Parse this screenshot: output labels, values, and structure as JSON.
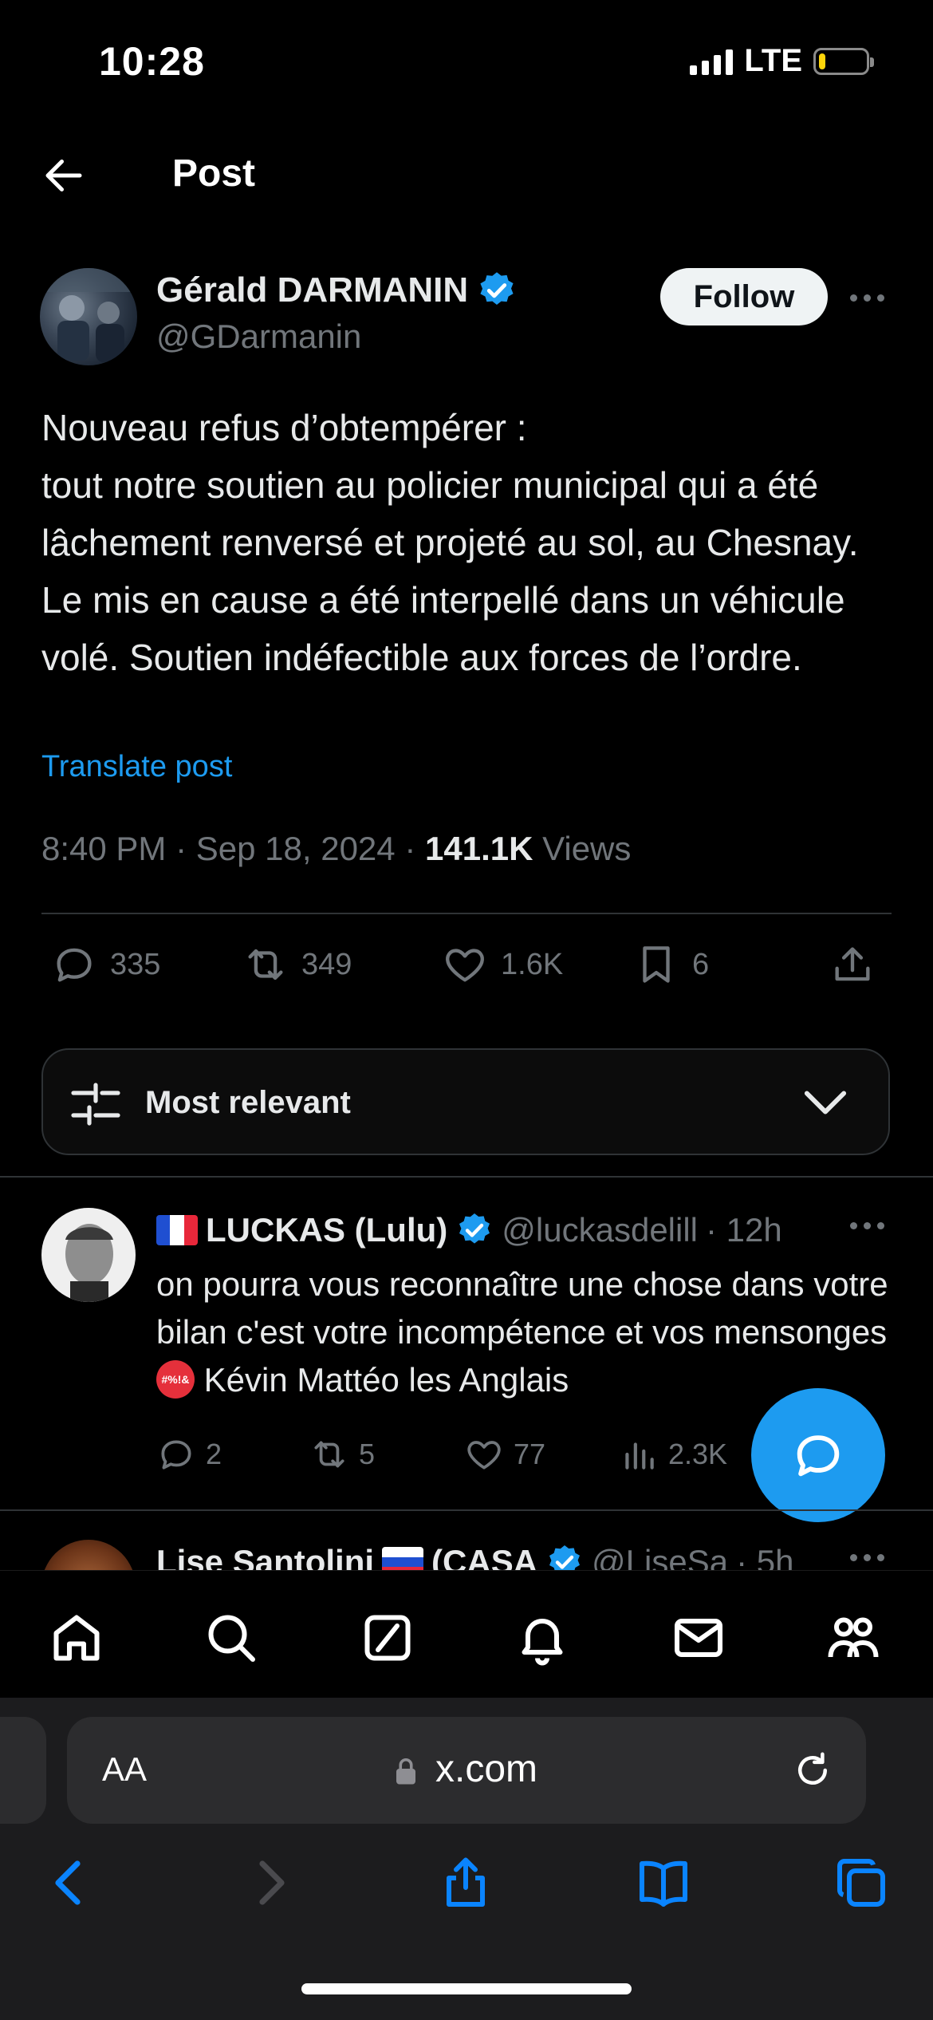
{
  "status": {
    "time": "10:28",
    "network": "LTE",
    "battery_level": 0.15
  },
  "header": {
    "title": "Post"
  },
  "author": {
    "name": "Gérald DARMANIN",
    "handle": "@GDarmanin",
    "follow_label": "Follow"
  },
  "post": {
    "text": "Nouveau refus d’obtempérer :\ntout notre soutien au policier municipal qui  a été lâchement renversé  et projeté au sol, au Chesnay. Le mis en cause a été interpellé dans un véhicule volé. Soutien indéfectible aux forces de l’ordre.",
    "translate_label": "Translate post",
    "time": "8:40 PM",
    "date": "Sep 18, 2024",
    "separator": "·",
    "views_count": "141.1K",
    "views_label": "Views"
  },
  "actions": {
    "replies": "335",
    "reposts": "349",
    "likes": "1.6K",
    "bookmarks": "6"
  },
  "filter": {
    "label": "Most relevant"
  },
  "reply": {
    "name": "LUCKAS (Lulu)",
    "handle": "@luckasdelill",
    "time_ago": "· 12h",
    "text_before": "on pourra vous reconnaître une chose dans votre bilan c'est votre incompétence et vos mensonges",
    "emoji_label": "#%!&",
    "text_after": "Kévin Mattéo les Anglais",
    "replies": "2",
    "reposts": "5",
    "likes": "77",
    "views": "2.3K"
  },
  "next_reply": {
    "name": "Lise Santolini",
    "suffix": "(CASA",
    "handle": "@LiseSa",
    "time_ago": "· 5h"
  },
  "browser": {
    "aa_label": "AA",
    "url": "x.com"
  },
  "colors": {
    "accent": "#1d9bf0",
    "background": "#000000",
    "muted": "#71767b"
  }
}
